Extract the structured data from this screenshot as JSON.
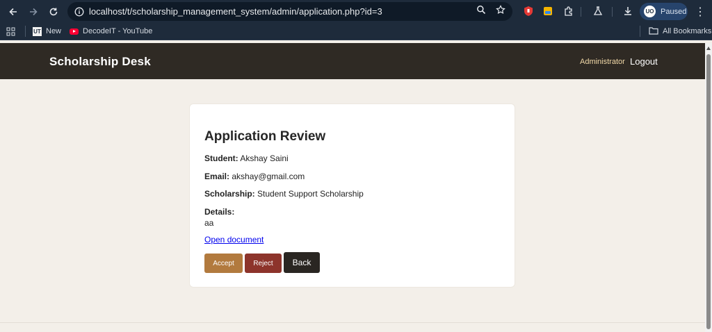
{
  "browser": {
    "url": "localhost/t/scholarship_management_system/admin/application.php?id=3",
    "profile_status": "Paused",
    "profile_initials": "UO",
    "bookmarks": [
      {
        "label": "New",
        "icon": "ut-icon"
      },
      {
        "label": "DecodeIT - YouTube",
        "icon": "youtube-icon"
      }
    ],
    "all_bookmarks_label": "All Bookmarks"
  },
  "header": {
    "brand": "Scholarship Desk",
    "admin_label": "Administrator",
    "logout_label": "Logout"
  },
  "review": {
    "title": "Application Review",
    "student_label": "Student:",
    "student_value": "Akshay Saini",
    "email_label": "Email:",
    "email_value": "akshay@gmail.com",
    "scholarship_label": "Scholarship:",
    "scholarship_value": "Student Support Scholarship",
    "details_label": "Details:",
    "details_value": "aa",
    "document_link": "Open document",
    "accept_label": "Accept",
    "reject_label": "Reject",
    "back_label": "Back"
  },
  "colors": {
    "header_bg": "#2f2a24",
    "page_bg": "#f3efe9",
    "accept": "#b27a3e",
    "reject": "#8d342b",
    "back": "#2a2622",
    "admin_link": "#f2d9a8"
  }
}
